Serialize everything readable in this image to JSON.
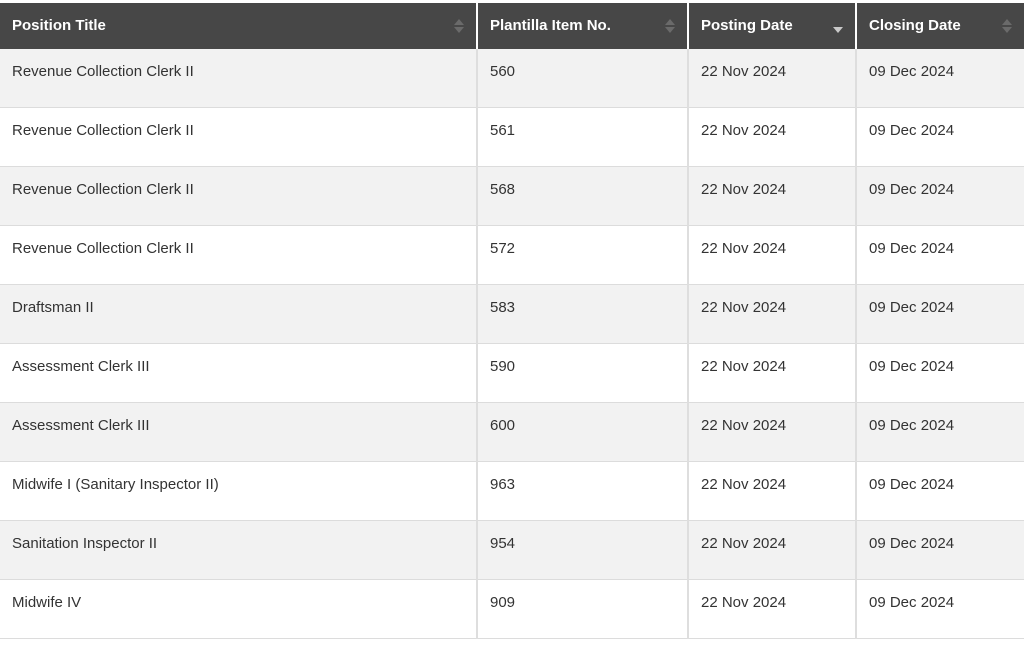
{
  "table": {
    "columns": [
      {
        "label": "Position Title",
        "sort": "none"
      },
      {
        "label": "Plantilla Item No.",
        "sort": "none"
      },
      {
        "label": "Posting Date",
        "sort": "descending"
      },
      {
        "label": "Closing Date",
        "sort": "none"
      }
    ],
    "rows": [
      {
        "position_title": "Revenue Collection Clerk II",
        "item_no": "560",
        "posting_date": "22 Nov 2024",
        "closing_date": "09 Dec 2024"
      },
      {
        "position_title": "Revenue Collection Clerk II",
        "item_no": "561",
        "posting_date": "22 Nov 2024",
        "closing_date": "09 Dec 2024"
      },
      {
        "position_title": "Revenue Collection Clerk II",
        "item_no": "568",
        "posting_date": "22 Nov 2024",
        "closing_date": "09 Dec 2024"
      },
      {
        "position_title": "Revenue Collection Clerk II",
        "item_no": "572",
        "posting_date": "22 Nov 2024",
        "closing_date": "09 Dec 2024"
      },
      {
        "position_title": "Draftsman II",
        "item_no": "583",
        "posting_date": "22 Nov 2024",
        "closing_date": "09 Dec 2024"
      },
      {
        "position_title": "Assessment Clerk III",
        "item_no": "590",
        "posting_date": "22 Nov 2024",
        "closing_date": "09 Dec 2024"
      },
      {
        "position_title": "Assessment Clerk III",
        "item_no": "600",
        "posting_date": "22 Nov 2024",
        "closing_date": "09 Dec 2024"
      },
      {
        "position_title": "Midwife I (Sanitary Inspector II)",
        "item_no": "963",
        "posting_date": "22 Nov 2024",
        "closing_date": "09 Dec 2024"
      },
      {
        "position_title": "Sanitation Inspector II",
        "item_no": "954",
        "posting_date": "22 Nov 2024",
        "closing_date": "09 Dec 2024"
      },
      {
        "position_title": "Midwife IV",
        "item_no": "909",
        "posting_date": "22 Nov 2024",
        "closing_date": "09 Dec 2024"
      }
    ]
  }
}
